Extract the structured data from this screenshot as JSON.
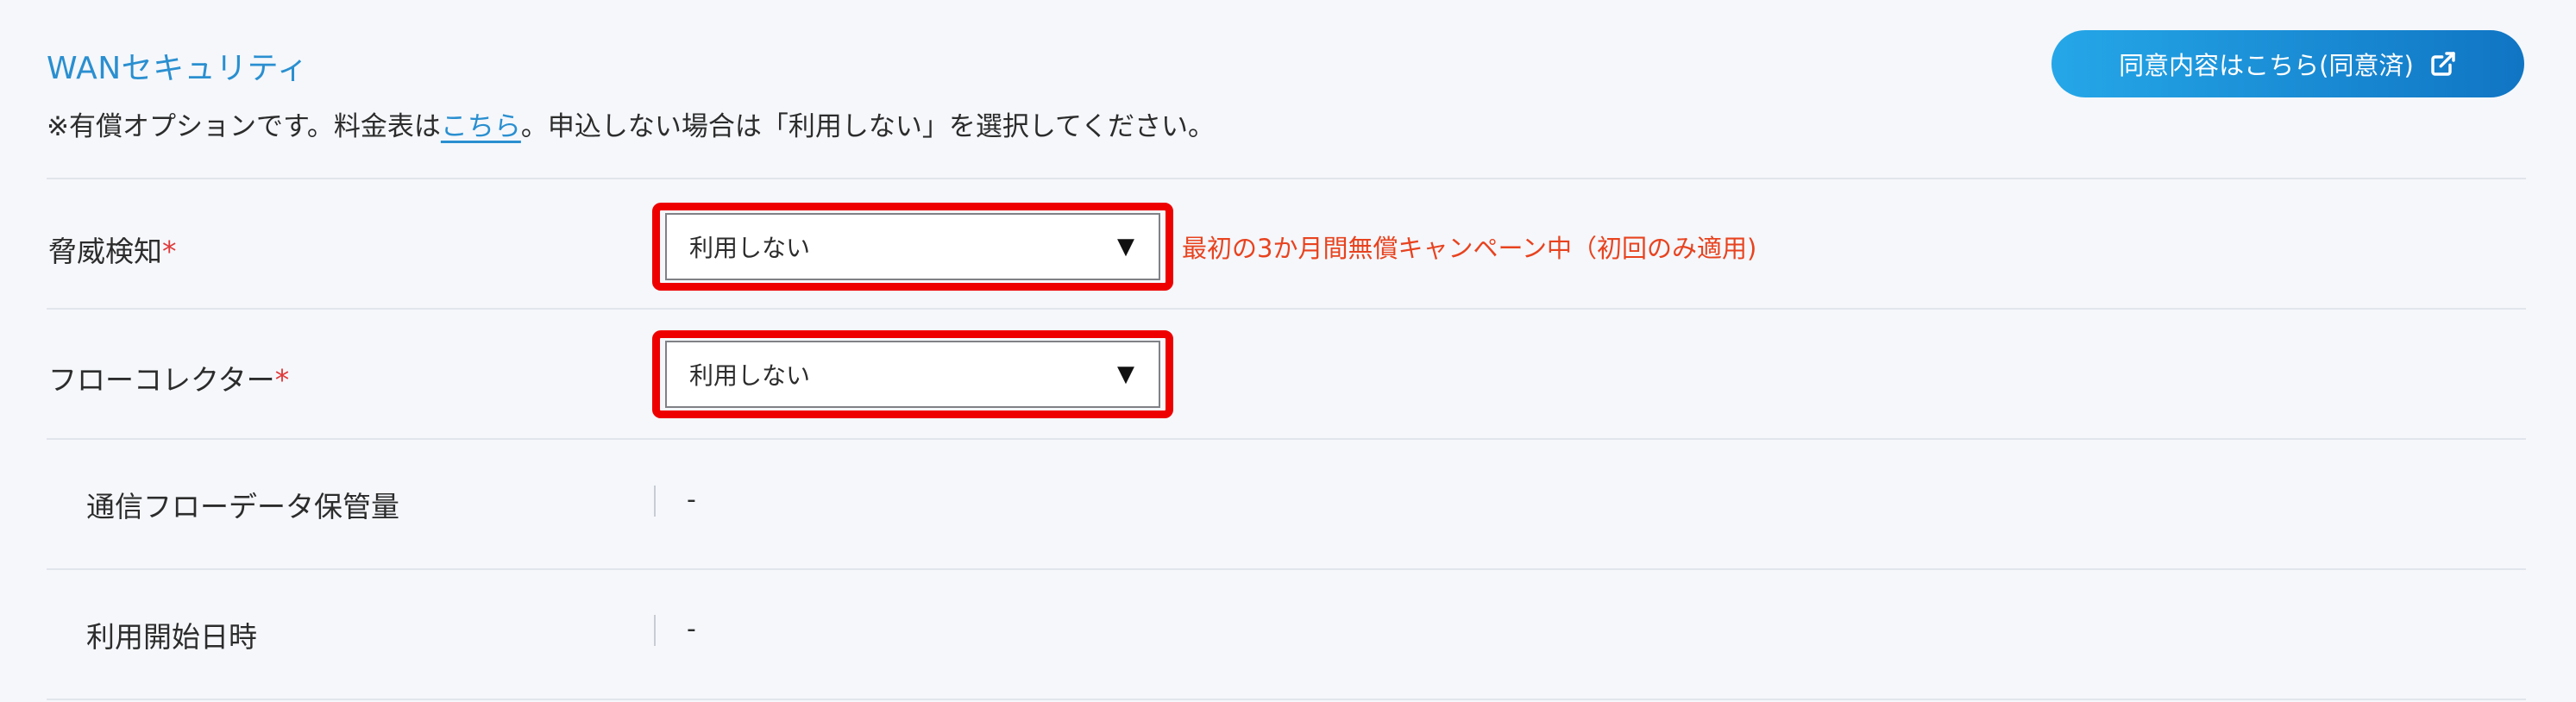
{
  "section": {
    "title": "WANセキュリティ",
    "note_prefix": "※有償オプションです。料金表は",
    "note_link": "こちら",
    "note_suffix": "。申込しない場合は「利用しない」を選択してください。",
    "consent_button": "同意内容はこちら(同意済)",
    "consent_icon": "external-link-icon"
  },
  "rows": [
    {
      "label": "脅威検知",
      "required_mark": "*",
      "select_value": "利用しない",
      "campaign_note": "最初の3か月間無償キャンペーン中（初回のみ適用)"
    },
    {
      "label": "フローコレクター",
      "required_mark": "*",
      "select_value": "利用しない"
    },
    {
      "label": "通信フローデータ保管量",
      "value": "-"
    },
    {
      "label": "利用開始日時",
      "value": "-"
    }
  ],
  "colors": {
    "title": "#2a8fd0",
    "link": "#2a8fd0",
    "required": "#e03a3a",
    "highlight_outline": "#ee0000",
    "campaign_text": "#e8431f",
    "button_gradient_start": "#25a7e8",
    "button_gradient_end": "#1075c4"
  }
}
